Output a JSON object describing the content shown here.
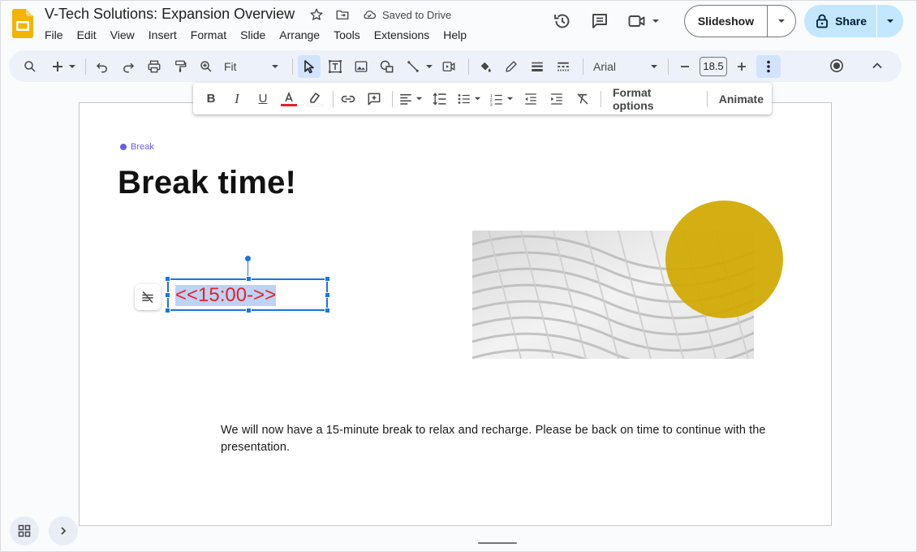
{
  "header": {
    "title": "V-Tech Solutions: Expansion Overview",
    "saved_status": "Saved to Drive",
    "slideshow_label": "Slideshow",
    "share_label": "Share"
  },
  "menu": [
    "File",
    "Edit",
    "View",
    "Insert",
    "Format",
    "Slide",
    "Arrange",
    "Tools",
    "Extensions",
    "Help"
  ],
  "toolbar": {
    "zoom_value": "Fit",
    "font_name": "Arial",
    "font_size": "18.5"
  },
  "format_bar": {
    "format_options_label": "Format options",
    "animate_label": "Animate"
  },
  "slide": {
    "kicker": "Break",
    "title": "Break time!",
    "timer_text": "<<15:00->>",
    "body": "We will now have a 15-minute break to relax and recharge. Please be back on time to continue with the presentation."
  },
  "colors": {
    "accent_blue": "#1a73e8",
    "timer_red": "#e8202b",
    "circle_gold": "#d0a800",
    "kicker_purple": "#6c5ce7"
  }
}
